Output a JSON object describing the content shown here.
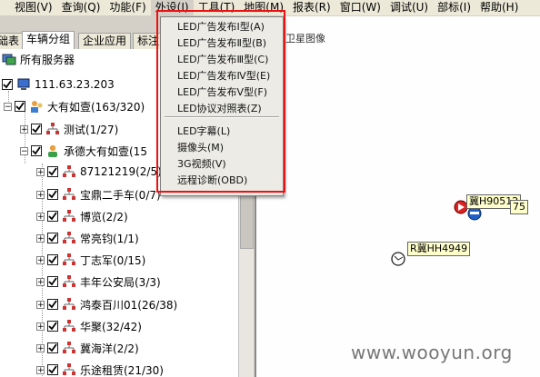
{
  "menubar": {
    "items": [
      "视图(V)",
      "查询(Q)",
      "功能(F)",
      "外设(I)",
      "工具(T)",
      "地图(M)",
      "报表(R)",
      "窗口(W)",
      "调试(U)",
      "部标(I)",
      "帮助(H)"
    ],
    "active": "外设(I)"
  },
  "tabs": [
    "础表",
    "车辆分组",
    "企业应用",
    "标注"
  ],
  "tree": {
    "root": "所有服务器",
    "server": "111.63.23.203",
    "company": "大有如壹(163/320)",
    "test_group": "测试(1/27)",
    "branch": "承德大有如壹(15",
    "children": [
      "87121219(2/5)",
      "宝鼎二手车(0/7)",
      "博览(2/2)",
      "常亮钧(1/1)",
      "丁志军(0/15)",
      "丰年公安局(3/3)",
      "鸿泰百川01(26/38)",
      "华聚(32/42)",
      "冀海洋(2/2)",
      "乐途租赁(21/30)"
    ]
  },
  "map": {
    "tab_label": "卫星图像",
    "vehicles": [
      {
        "plate": "冀H90512",
        "extra": "75"
      },
      {
        "plate": "R冀HH4949"
      }
    ]
  },
  "dropdown": {
    "items": [
      "LED广告发布Ⅰ型(A)",
      "LED广告发布Ⅱ型(B)",
      "LED广告发布Ⅲ型(C)",
      "LED广告发布Ⅳ型(E)",
      "LED广告发布Ⅴ型(F)",
      "LED协议对照表(Z)",
      "LED字幕(L)",
      "摄像头(M)",
      "3G视频(V)",
      "远程诊断(OBD)"
    ]
  },
  "watermark": "www.wooyun.org",
  "colors": {
    "highlight_box": "#e11111",
    "menubar": "#ece9d8"
  }
}
